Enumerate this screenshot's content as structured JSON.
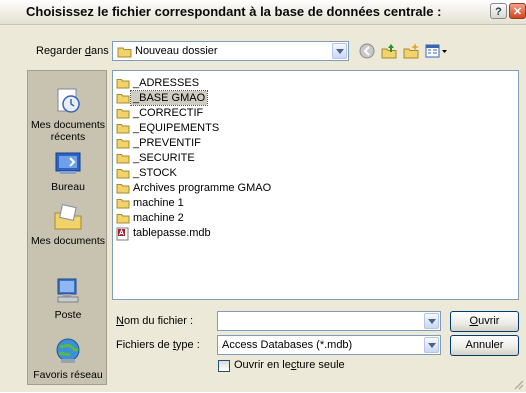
{
  "dialog": {
    "title": "Choisissez le fichier correspondant à la base de données centrale :",
    "help_glyph": "?",
    "close_glyph": "✕"
  },
  "lookin": {
    "label_pre": "Regarder ",
    "label_u": "d",
    "label_post": "ans :",
    "value": "Nouveau dossier"
  },
  "toolbar": {
    "icons": [
      "back-icon",
      "up-folder-icon",
      "new-folder-icon",
      "view-menu-icon"
    ]
  },
  "places": [
    {
      "label": "Mes documents récents",
      "icon": "recent-documents-icon"
    },
    {
      "label": "Bureau",
      "icon": "desktop-icon"
    },
    {
      "label": "Mes documents",
      "icon": "my-documents-icon"
    },
    {
      "label": "Poste",
      "icon": "computer-icon"
    },
    {
      "label": "Favoris réseau",
      "icon": "network-icon"
    }
  ],
  "files": [
    {
      "name": "_ADRESSES",
      "type": "folder",
      "selected": false
    },
    {
      "name": "_BASE GMAO",
      "type": "folder",
      "selected": true
    },
    {
      "name": "_CORRECTIF",
      "type": "folder",
      "selected": false
    },
    {
      "name": "_EQUIPEMENTS",
      "type": "folder",
      "selected": false
    },
    {
      "name": "_PREVENTIF",
      "type": "folder",
      "selected": false
    },
    {
      "name": "_SECURITE",
      "type": "folder",
      "selected": false
    },
    {
      "name": "_STOCK",
      "type": "folder",
      "selected": false
    },
    {
      "name": "Archives programme GMAO",
      "type": "folder",
      "selected": false
    },
    {
      "name": "machine 1",
      "type": "folder",
      "selected": false
    },
    {
      "name": "machine 2",
      "type": "folder",
      "selected": false
    },
    {
      "name": "tablepasse.mdb",
      "type": "access-file",
      "selected": false
    }
  ],
  "filename": {
    "label_u": "N",
    "label_post": "om du fichier :",
    "value": ""
  },
  "filetype": {
    "label_pre": "Fichiers de ",
    "label_u": "t",
    "label_post": "ype :",
    "value": "Access Databases (*.mdb)"
  },
  "buttons": {
    "open_u": "O",
    "open_post": "uvrir",
    "cancel": "Annuler"
  },
  "readonly": {
    "label_pre": "Ouvrir en le",
    "label_u": "c",
    "label_post": "ture seule",
    "checked": false
  },
  "colors": {
    "folder": "#f2d26b",
    "selection": "#cfcdc2",
    "dialog_bg": "#ece9d8",
    "places_bg": "#c7c3b0"
  }
}
